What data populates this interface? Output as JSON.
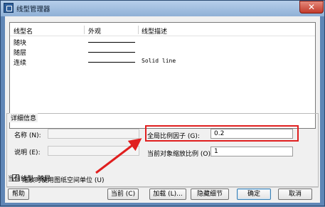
{
  "window": {
    "title": "线型管理器",
    "close_glyph": "✕"
  },
  "list": {
    "columns": [
      "线型名",
      "外观",
      "线型描述"
    ],
    "rows": [
      {
        "name": "随块",
        "description": ""
      },
      {
        "name": "随层",
        "description": ""
      },
      {
        "name": "连续",
        "description": "Solid line"
      }
    ]
  },
  "details": {
    "section_title": "详细信息",
    "name_label": "名称 (N):",
    "name_value": "",
    "desc_label": "说明 (E):",
    "desc_value": "",
    "global_scale_label": "全局比例因子 (G):",
    "global_scale_value": "0.2",
    "current_scale_label": "当前对象缩放比例 (O):",
    "current_scale_value": "1",
    "paper_units_label": "缩放时使用图纸空间单位 (U)",
    "paper_units_checked": "✓"
  },
  "current": {
    "label": "当前线型: 随层"
  },
  "buttons": {
    "help": "帮助",
    "current": "当前 (C)",
    "load": "加载 (L)...",
    "hide_details": "隐藏细节",
    "ok": "确定",
    "cancel": "取消"
  },
  "colors": {
    "highlight": "#e01f1f",
    "arrow": "#e01f1f"
  }
}
